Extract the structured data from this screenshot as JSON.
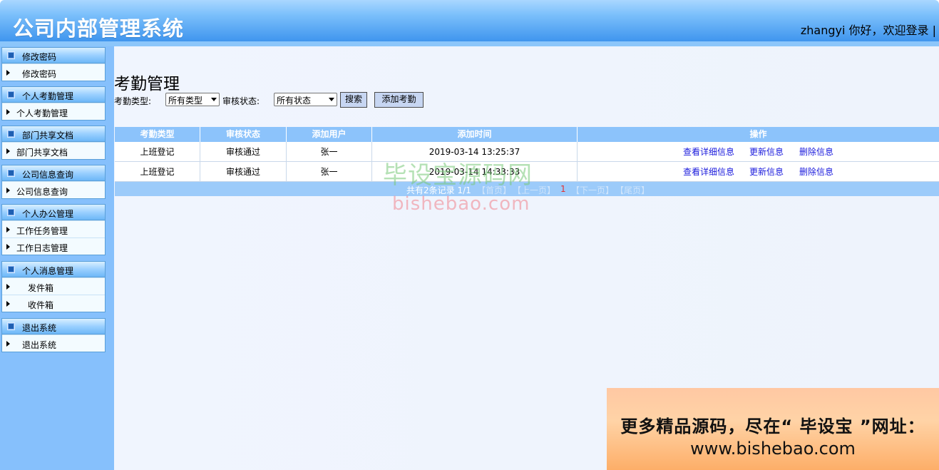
{
  "header": {
    "title": "公司内部管理系统",
    "user_greeting": "zhangyi 你好，欢迎登录 |"
  },
  "sidebar": {
    "groups": [
      {
        "title": "修改密码",
        "items": [
          "修改密码"
        ]
      },
      {
        "title": "个人考勤管理",
        "items": [
          "个人考勤管理"
        ]
      },
      {
        "title": "部门共享文档",
        "items": [
          "部门共享文档"
        ]
      },
      {
        "title": "公司信息查询",
        "items": [
          "公司信息查询"
        ]
      },
      {
        "title": "个人办公管理",
        "items": [
          "工作任务管理",
          "工作日志管理"
        ]
      },
      {
        "title": "个人消息管理",
        "items": [
          "发件箱",
          "收件箱"
        ]
      },
      {
        "title": "退出系统",
        "items": [
          "退出系统"
        ]
      }
    ]
  },
  "main": {
    "page_title": "考勤管理",
    "filters": {
      "type_label": "考勤类型:",
      "type_value": "所有类型",
      "status_label": "审核状态:",
      "status_value": "所有状态",
      "search_button": "搜索",
      "add_button": "添加考勤"
    },
    "table": {
      "columns": [
        "考勤类型",
        "审核状态",
        "添加用户",
        "添加时间",
        "操作"
      ],
      "rows": [
        {
          "type": "上班登记",
          "status": "审核通过",
          "user": "张一",
          "time": "2019-03-14 13:25:37"
        },
        {
          "type": "上班登记",
          "status": "审核通过",
          "user": "张一",
          "time": "2019-03-14 14:33:33"
        }
      ],
      "actions": {
        "view": "查看详细信息",
        "update": "更新信息",
        "delete": "删除信息"
      }
    },
    "pagination": {
      "info": "共有2条记录  1/1",
      "first": "【首页】",
      "prev": "【上一页】",
      "current": "1",
      "next": "【下一页】",
      "last": "【尾页】"
    }
  },
  "watermark": {
    "line1": "毕设宝源码网",
    "line2": "bishebao.com"
  },
  "promo": {
    "line1": "更多精品源码，尽在“ 毕设宝 ”网址：",
    "line2": "www.bishebao.com"
  }
}
